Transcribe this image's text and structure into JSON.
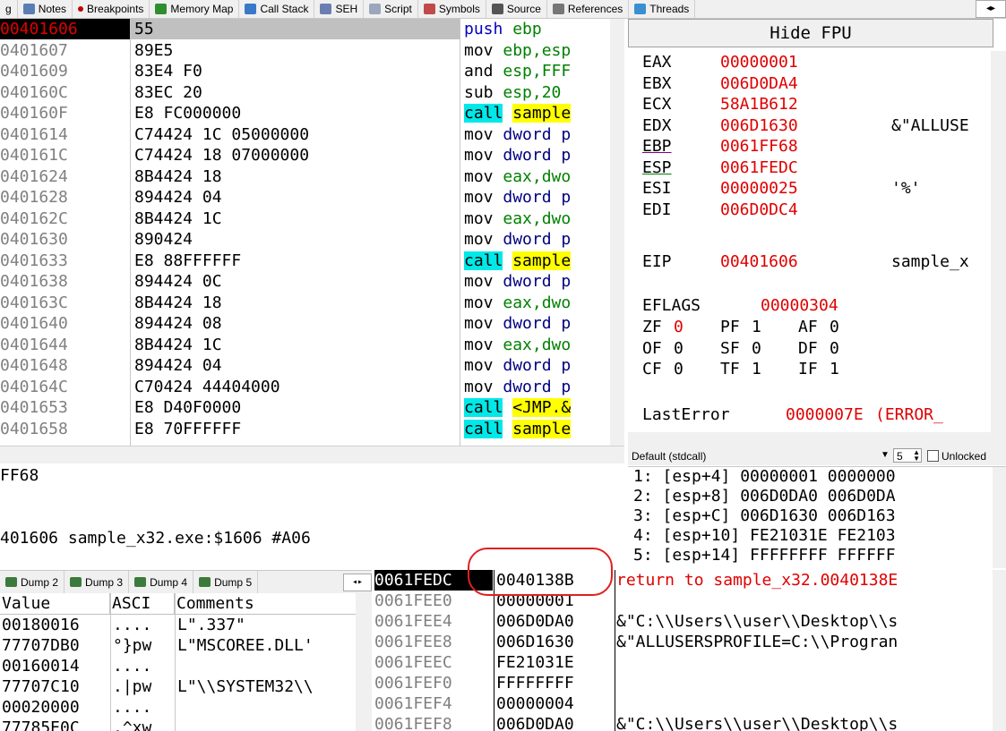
{
  "tabs": [
    {
      "label": "g",
      "icon": "none"
    },
    {
      "label": "Notes",
      "icon": "notes-icon"
    },
    {
      "label": "Breakpoints",
      "icon": "breakpoint-dot-icon"
    },
    {
      "label": "Memory Map",
      "icon": "memory-map-icon"
    },
    {
      "label": "Call Stack",
      "icon": "call-stack-icon"
    },
    {
      "label": "SEH",
      "icon": "seh-icon"
    },
    {
      "label": "Script",
      "icon": "script-icon"
    },
    {
      "label": "Symbols",
      "icon": "symbols-icon"
    },
    {
      "label": "Source",
      "icon": "source-icon"
    },
    {
      "label": "References",
      "icon": "references-icon"
    },
    {
      "label": "Threads",
      "icon": "threads-icon"
    }
  ],
  "colors": {
    "red": "#e00000",
    "call_bg": "#00e8e8",
    "call_target_bg": "#ffff00",
    "green": "#008000",
    "blue": "#000080",
    "annotation": "#e0201e"
  },
  "disasm": [
    {
      "addr": "00401606",
      "bytes": "55",
      "mnem": "push",
      "ops": "ebp",
      "type": "push"
    },
    {
      "addr": "0401607",
      "bytes": "89E5",
      "mnem": "mov",
      "ops": "ebp,esp",
      "type": "mov"
    },
    {
      "addr": "0401609",
      "bytes": "83E4 F0",
      "mnem": "and",
      "ops": "esp,FFF",
      "type": "alu"
    },
    {
      "addr": "040160C",
      "bytes": "83EC 20",
      "mnem": "sub",
      "ops": "esp,20",
      "type": "alu"
    },
    {
      "addr": "040160F",
      "bytes": "E8 FC000000",
      "mnem": "call",
      "ops": "sample",
      "type": "call"
    },
    {
      "addr": "0401614",
      "bytes": "C74424 1C 05000000",
      "mnem": "mov",
      "ops": "dword p",
      "type": "mov"
    },
    {
      "addr": "040161C",
      "bytes": "C74424 18 07000000",
      "mnem": "mov",
      "ops": "dword p",
      "type": "mov"
    },
    {
      "addr": "0401624",
      "bytes": "8B4424 18",
      "mnem": "mov",
      "ops": "eax,dwo",
      "type": "mov"
    },
    {
      "addr": "0401628",
      "bytes": "894424 04",
      "mnem": "mov",
      "ops": "dword p",
      "type": "mov"
    },
    {
      "addr": "040162C",
      "bytes": "8B4424 1C",
      "mnem": "mov",
      "ops": "eax,dwo",
      "type": "mov"
    },
    {
      "addr": "0401630",
      "bytes": "890424",
      "mnem": "mov",
      "ops": "dword p",
      "type": "mov"
    },
    {
      "addr": "0401633",
      "bytes": "E8 88FFFFFF",
      "mnem": "call",
      "ops": "sample",
      "type": "call"
    },
    {
      "addr": "0401638",
      "bytes": "894424 0C",
      "mnem": "mov",
      "ops": "dword p",
      "type": "mov"
    },
    {
      "addr": "040163C",
      "bytes": "8B4424 18",
      "mnem": "mov",
      "ops": "eax,dwo",
      "type": "mov"
    },
    {
      "addr": "0401640",
      "bytes": "894424 08",
      "mnem": "mov",
      "ops": "dword p",
      "type": "mov"
    },
    {
      "addr": "0401644",
      "bytes": "8B4424 1C",
      "mnem": "mov",
      "ops": "eax,dwo",
      "type": "mov"
    },
    {
      "addr": "0401648",
      "bytes": "894424 04",
      "mnem": "mov",
      "ops": "dword p",
      "type": "mov"
    },
    {
      "addr": "040164C",
      "bytes": "C70424 44404000",
      "mnem": "mov",
      "ops": "dword p",
      "type": "mov"
    },
    {
      "addr": "0401653",
      "bytes": "E8 D40F0000",
      "mnem": "call",
      "ops": "<JMP.&",
      "type": "call"
    },
    {
      "addr": "0401658",
      "bytes": "E8 70FFFFFF",
      "mnem": "call",
      "ops": "sample",
      "type": "call"
    }
  ],
  "regs": {
    "hide_fpu": "Hide FPU",
    "gp": [
      {
        "name": "EAX",
        "val": "00000001",
        "comment": ""
      },
      {
        "name": "EBX",
        "val": "006D0DA4",
        "comment": ""
      },
      {
        "name": "ECX",
        "val": "58A1B612",
        "comment": ""
      },
      {
        "name": "EDX",
        "val": "006D1630",
        "comment": "&\"ALLUSE"
      },
      {
        "name": "EBP",
        "val": "0061FF68",
        "comment": ""
      },
      {
        "name": "ESP",
        "val": "0061FEDC",
        "comment": ""
      },
      {
        "name": "ESI",
        "val": "00000025",
        "comment": "'%'"
      },
      {
        "name": "EDI",
        "val": "006D0DC4",
        "comment": ""
      }
    ],
    "eip": {
      "name": "EIP",
      "val": "00401606",
      "comment": "sample_x"
    },
    "eflags": {
      "name": "EFLAGS",
      "val": "00000304"
    },
    "flags_rows": [
      [
        {
          "n": "ZF",
          "v": "0",
          "red": true
        },
        {
          "n": "PF",
          "v": "1"
        },
        {
          "n": "AF",
          "v": "0"
        }
      ],
      [
        {
          "n": "OF",
          "v": "0"
        },
        {
          "n": "SF",
          "v": "0"
        },
        {
          "n": "DF",
          "v": "0"
        }
      ],
      [
        {
          "n": "CF",
          "v": "0"
        },
        {
          "n": "TF",
          "v": "1"
        },
        {
          "n": "IF",
          "v": "1"
        }
      ]
    ],
    "lasterror": {
      "name": "LastError",
      "val": "0000007E",
      "comment": "(ERROR_"
    }
  },
  "callconv": {
    "label": "Default (stdcall)",
    "count": "5",
    "unlocked": "Unlocked"
  },
  "stackargs": [
    "1: [esp+4] 00000001 0000000",
    "2: [esp+8] 006D0DA0 006D0DA",
    "3: [esp+C] 006D1630 006D163",
    "4: [esp+10] FE21031E FE2103",
    "5: [esp+14] FFFFFFFF FFFFFF"
  ],
  "info": {
    "line1": "FF68",
    "line2": "401606 sample_x32.exe:$1606 #A06"
  },
  "dumptabs": [
    "Dump 2",
    "Dump 3",
    "Dump 4",
    "Dump 5"
  ],
  "dump": {
    "headers": [
      "Value",
      "ASCI",
      "Comments"
    ],
    "rows": [
      {
        "val": "00180016",
        "ascii": "....",
        "comment": "L\".337\""
      },
      {
        "val": "77707DB0",
        "ascii": "°}pw",
        "comment": "L\"MSCOREE.DLL'"
      },
      {
        "val": "00160014",
        "ascii": "....",
        "comment": ""
      },
      {
        "val": "77707C10",
        "ascii": ".|pw",
        "comment": "L\"\\\\SYSTEM32\\\\"
      },
      {
        "val": "00020000",
        "ascii": "....",
        "comment": ""
      },
      {
        "val": "77785E0C",
        "ascii": ".^xw",
        "comment": ""
      }
    ]
  },
  "stack": [
    {
      "addr": "0061FEDC",
      "val": "0040138B",
      "comment": "return to sample_x32.0040138E",
      "current": true
    },
    {
      "addr": "0061FEE0",
      "val": "00000001",
      "comment": ""
    },
    {
      "addr": "0061FEE4",
      "val": "006D0DA0",
      "comment": "&\"C:\\\\Users\\\\user\\\\Desktop\\\\s"
    },
    {
      "addr": "0061FEE8",
      "val": "006D1630",
      "comment": "&\"ALLUSERSPROFILE=C:\\\\Progran"
    },
    {
      "addr": "0061FEEC",
      "val": "FE21031E",
      "comment": ""
    },
    {
      "addr": "0061FEF0",
      "val": "FFFFFFFF",
      "comment": ""
    },
    {
      "addr": "0061FEF4",
      "val": "00000004",
      "comment": ""
    },
    {
      "addr": "0061FEF8",
      "val": "006D0DA0",
      "comment": "&\"C:\\\\Users\\\\user\\\\Desktop\\\\s"
    }
  ]
}
